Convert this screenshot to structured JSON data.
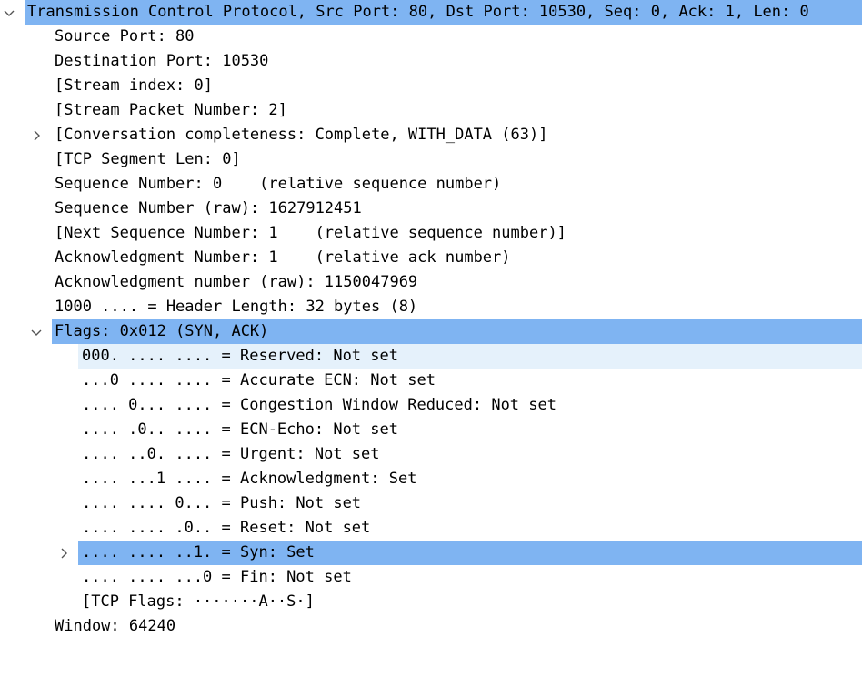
{
  "tree": {
    "tcp_header": "Transmission Control Protocol, Src Port: 80, Dst Port: 10530, Seq: 0, Ack: 1, Len: 0",
    "source_port": "Source Port: 80",
    "destination_port": "Destination Port: 10530",
    "stream_index": "[Stream index: 0]",
    "stream_packet_number": "[Stream Packet Number: 2]",
    "conversation_completeness": "[Conversation completeness: Complete, WITH_DATA (63)]",
    "tcp_segment_len": "[TCP Segment Len: 0]",
    "sequence_number": "Sequence Number: 0    (relative sequence number)",
    "sequence_number_raw": "Sequence Number (raw): 1627912451",
    "next_sequence_number": "[Next Sequence Number: 1    (relative sequence number)]",
    "ack_number": "Acknowledgment Number: 1    (relative ack number)",
    "ack_number_raw": "Acknowledgment number (raw): 1150047969",
    "header_length": "1000 .... = Header Length: 32 bytes (8)",
    "flags": "Flags: 0x012 (SYN, ACK)",
    "flag_reserved": "000. .... .... = Reserved: Not set",
    "flag_accurate_ecn": "...0 .... .... = Accurate ECN: Not set",
    "flag_cwr": ".... 0... .... = Congestion Window Reduced: Not set",
    "flag_ecn_echo": ".... .0.. .... = ECN-Echo: Not set",
    "flag_urgent": ".... ..0. .... = Urgent: Not set",
    "flag_ack": ".... ...1 .... = Acknowledgment: Set",
    "flag_push": ".... .... 0... = Push: Not set",
    "flag_reset": ".... .... .0.. = Reset: Not set",
    "flag_syn": ".... .... ..1. = Syn: Set",
    "flag_fin": ".... .... ...0 = Fin: Not set",
    "tcp_flags": "[TCP Flags: ·······A··S·]",
    "window": "Window: 64240"
  },
  "icons": {
    "expanded": "chevron-down-icon",
    "collapsed": "chevron-right-icon"
  },
  "colors": {
    "selected_row": "#7fb4f2",
    "hover_row": "#e5f1fb",
    "chevron": "#555555"
  }
}
